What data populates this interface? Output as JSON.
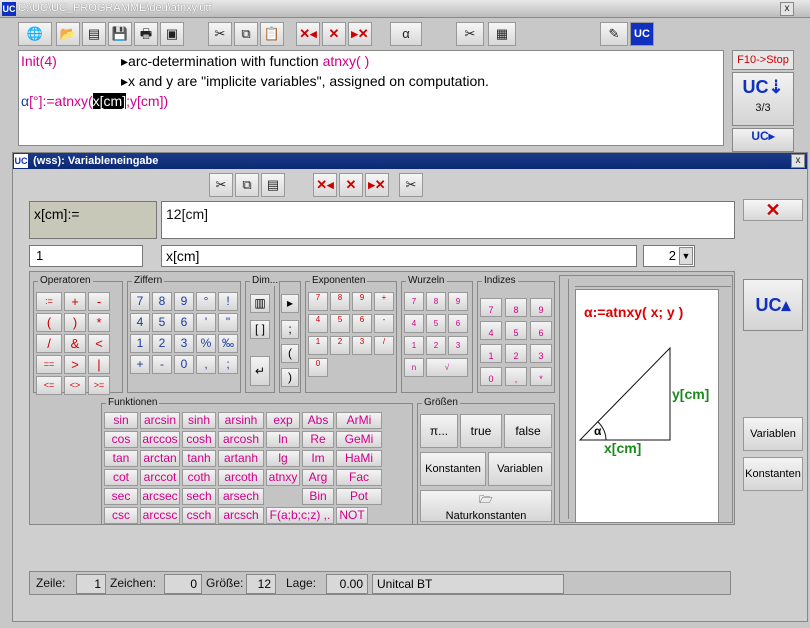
{
  "window": {
    "title": "C:\\UC\\UC_PROGRAMME\\deu\\atnxy.utf",
    "logo": "UC",
    "close": "x"
  },
  "toolbar": {
    "alpha": "α",
    "cut": "✂",
    "copy": "⧉",
    "paste": "📋"
  },
  "editor": {
    "line1a": "Init(4)",
    "line1b": "▸arc-determination with function",
    "line1c": "atnxy( )",
    "line2a": "▸x and y are \"implicite variables\", assigned on computation.",
    "line3a": "α",
    "line3b": "[°]:=atnxy(",
    "line3c": "x[cm]",
    "line3d": ";y[cm])"
  },
  "side": {
    "stop": "F10->Stop",
    "page": "3/3",
    "variablen": "Variablen",
    "konstanten": "Konstanten"
  },
  "dialog": {
    "title": "(wss): Variableneingabe",
    "close": "x",
    "varname": "x[cm]:=",
    "value": "12[cm]",
    "index": "1",
    "var_sel": "x[cm]",
    "num": "2",
    "cancel": "✕"
  },
  "groups": {
    "operatoren": "Operatoren",
    "ziffern": "Ziffern",
    "dim": "Dim...",
    "exponenten": "Exponenten",
    "wurzeln": "Wurzeln",
    "indizes": "Indizes",
    "funktionen": "Funktionen",
    "groessen": "Größen"
  },
  "operators": [
    ":=",
    "+",
    "-",
    "(",
    ")",
    "*",
    "/",
    "&",
    "<",
    "==",
    ">",
    "|",
    "<=",
    "<>",
    ">="
  ],
  "digits": [
    "7",
    "8",
    "9",
    "°",
    "!",
    "4",
    "5",
    "6",
    "'",
    "\"",
    "1",
    "2",
    "3",
    "%",
    "‰",
    "+",
    "-",
    "0",
    ",",
    ";"
  ],
  "functions": [
    "sin",
    "arcsin",
    "sinh",
    "arsinh",
    "exp",
    "Abs",
    "ArMi",
    "cos",
    "arccos",
    "cosh",
    "arcosh",
    "ln",
    "Re",
    "GeMi",
    "tan",
    "arctan",
    "tanh",
    "artanh",
    "lg",
    "Im",
    "HaMi",
    "cot",
    "arccot",
    "coth",
    "arcoth",
    "atnxy",
    "Arg",
    "Fac",
    "sec",
    "arcsec",
    "sech",
    "arsech",
    "",
    "Bin",
    "Pot",
    "csc",
    "arccsc",
    "csch",
    "arcsch",
    "F(a;b;c;z) ,.",
    "NOT"
  ],
  "groessen": {
    "pi": "π...",
    "true": "true",
    "false": "false",
    "konstanten": "Konstanten",
    "variablen": "Variablen",
    "natur": "Naturkonstanten"
  },
  "preview": {
    "formula": "α:=atnxy( x; y )",
    "y": "y[cm]",
    "x": "x[cm]",
    "alpha": "α"
  },
  "status": {
    "zeile_l": "Zeile:",
    "zeile": "1",
    "zeichen_l": "Zeichen:",
    "zeichen": "0",
    "groesse_l": "Größe:",
    "groesse": "12",
    "lage_l": "Lage:",
    "lage": "0.00",
    "font": "Unitcal BT"
  }
}
